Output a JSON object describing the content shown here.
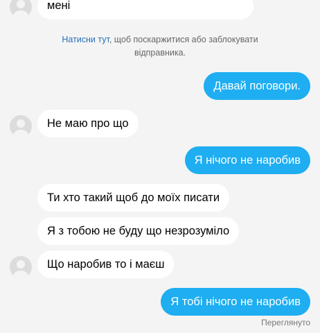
{
  "conversation": {
    "top_message": "мені",
    "report_notice": {
      "link_text": "Натисни тут",
      "line1_rest": ", щоб поскаржитися або заблокувати",
      "line2": "відправника."
    },
    "messages": [
      {
        "from": "me",
        "text": "Давай поговори."
      },
      {
        "from": "them",
        "text": "Не маю про що"
      },
      {
        "from": "me",
        "text": "Я нічого не наробив"
      },
      {
        "from": "them",
        "text": "Ти хто такий щоб до моїх писати"
      },
      {
        "from": "them",
        "text": "Я з тобою не буду що незрозуміло"
      },
      {
        "from": "them",
        "text": "Що наробив то і маєш"
      },
      {
        "from": "me",
        "text": "Я тобі нічого не наробив"
      }
    ],
    "seen_status": "Переглянуто"
  },
  "colors": {
    "outgoing_bubble": "#1eaef1",
    "incoming_bubble": "#ffffff",
    "background": "#f4f4f4",
    "link": "#2b6fb8"
  },
  "icons": {
    "avatar": "default-user-avatar-icon"
  }
}
